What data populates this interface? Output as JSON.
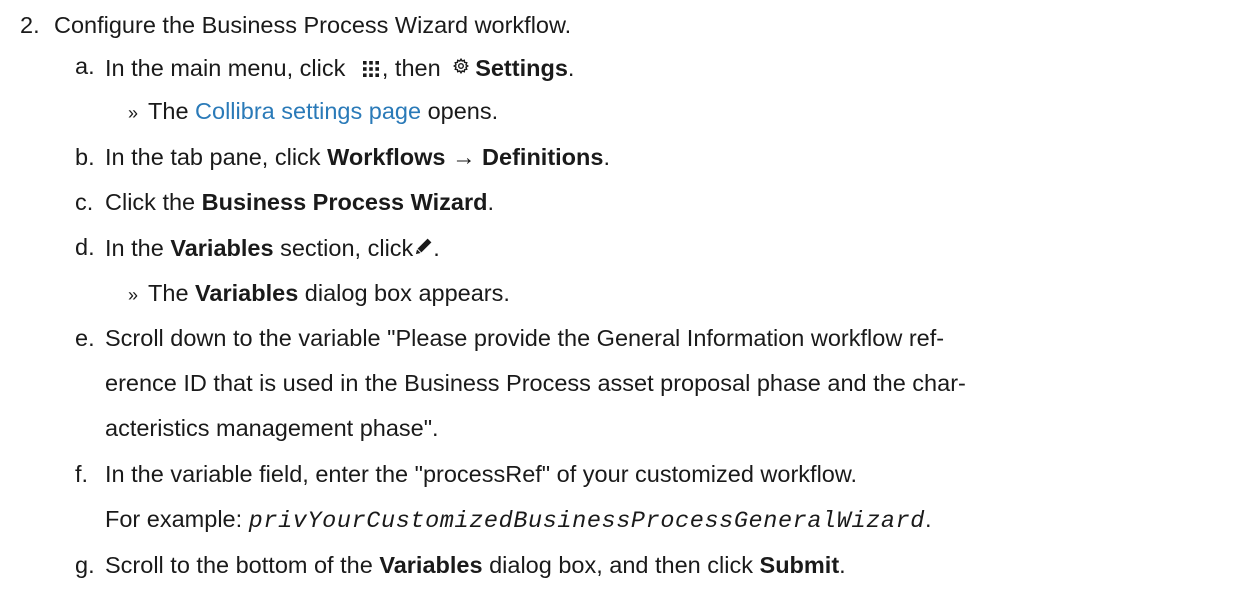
{
  "step": {
    "number": "2.",
    "title": "Configure the Business Process Wizard workflow."
  },
  "substeps": {
    "a": {
      "letter": "a.",
      "t1": "In the main menu, click",
      "t2": ", then",
      "settings": "Settings",
      "end": ".",
      "result_mark": "»",
      "result_pre": "The",
      "result_link": "Collibra settings page",
      "result_post": "opens."
    },
    "b": {
      "letter": "b.",
      "t1": "In the tab pane, click",
      "workflows": "Workflows",
      "arrow": "→",
      "definitions": "Definitions",
      "end": "."
    },
    "c": {
      "letter": "c.",
      "t1": "Click the",
      "bold": "Business Process Wizard",
      "end": "."
    },
    "d": {
      "letter": "d.",
      "t1": "In the",
      "variables": "Variables",
      "t2": "section, click",
      "end": ".",
      "result_mark": "»",
      "result_pre": "The",
      "result_bold": "Variables",
      "result_post": "dialog box appears."
    },
    "e": {
      "letter": "e.",
      "line1": "Scroll down to the variable \"Please provide the General Information workflow ref-",
      "line2": "erence ID that is used in the Business Process asset proposal phase and the char-",
      "line3": "acteristics management phase\"."
    },
    "f": {
      "letter": "f.",
      "line1": "In the variable field, enter the \"processRef\" of your customized workflow.",
      "example_label": "For example:",
      "example_code": "privYourCustomizedBusinessProcessGeneralWizard",
      "end": "."
    },
    "g": {
      "letter": "g.",
      "t1": "Scroll to the bottom of the",
      "variables": "Variables",
      "t2": "dialog box, and then click",
      "submit": "Submit",
      "end": "."
    }
  },
  "icons": {
    "menu": "apps-grid-icon",
    "settings": "gear-icon",
    "edit": "pencil-icon"
  },
  "colors": {
    "text": "#1a1a1a",
    "link": "#2a7ab8",
    "background": "#ffffff"
  }
}
